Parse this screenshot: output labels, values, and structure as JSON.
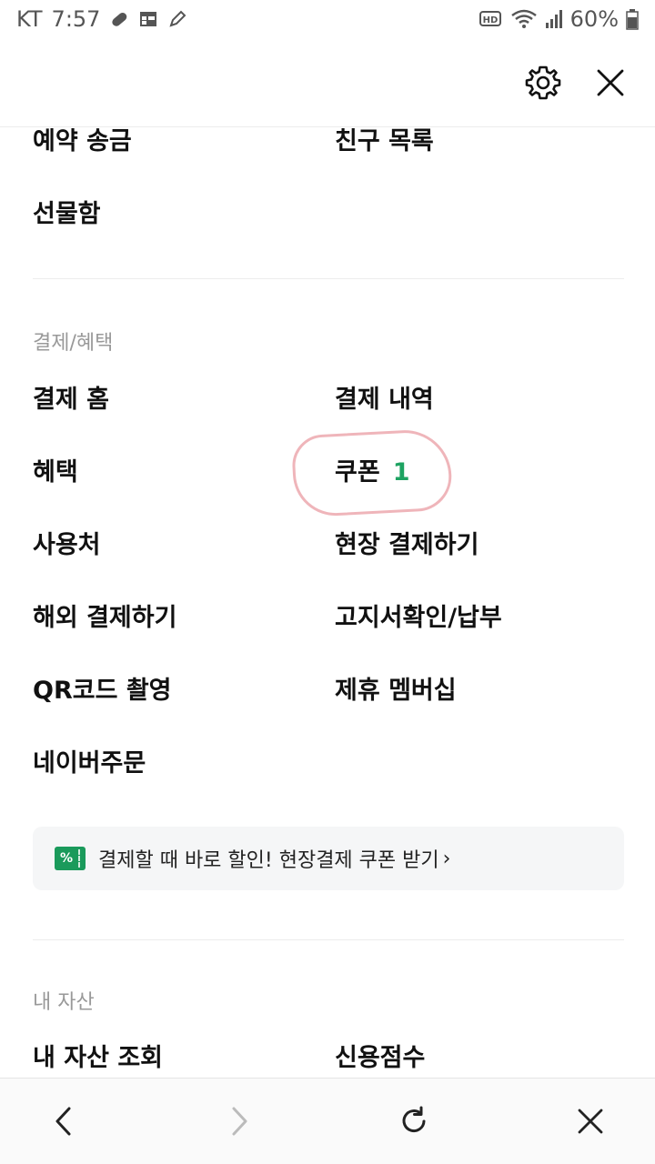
{
  "status_bar": {
    "carrier": "KT",
    "time": "7:57",
    "network_badge": "HD",
    "battery": "60%",
    "icons": [
      "pill-icon",
      "calendar-icon",
      "edit-icon",
      "hd-icon",
      "wifi-icon",
      "signal-icon",
      "battery-icon"
    ]
  },
  "header": {
    "settings_icon": "gear-icon",
    "close_icon": "close-icon"
  },
  "top_items": {
    "reserved_transfer": "예약 송금",
    "friend_list": "친구 목록",
    "gift_box": "선물함"
  },
  "payment_section": {
    "title": "결제/혜택",
    "items": {
      "payment_home": "결제 홈",
      "payment_history": "결제 내역",
      "benefits": "혜택",
      "coupon": "쿠폰",
      "coupon_count": "1",
      "merchants": "사용처",
      "onsite_payment": "현장 결제하기",
      "overseas_payment": "해외 결제하기",
      "bill_check": "고지서확인/납부",
      "qr_scan": "QR코드 촬영",
      "partner_membership": "제휴 멤버십",
      "naver_order": "네이버주문"
    },
    "promo": {
      "icon_text": "%",
      "text": "결제할 때 바로 할인! 현장결제 쿠폰 받기",
      "arrow": "›"
    }
  },
  "assets_section": {
    "title": "내 자산",
    "items": {
      "asset_lookup": "내 자산 조회",
      "credit_score": "신용점수"
    }
  },
  "bottom_nav": {
    "back_icon": "chevron-left-icon",
    "forward_icon": "chevron-right-icon",
    "refresh_icon": "refresh-icon",
    "close_icon": "close-icon"
  },
  "colors": {
    "accent_green": "#1ea362",
    "annotation_red": "#e27882",
    "divider": "#ececec"
  }
}
